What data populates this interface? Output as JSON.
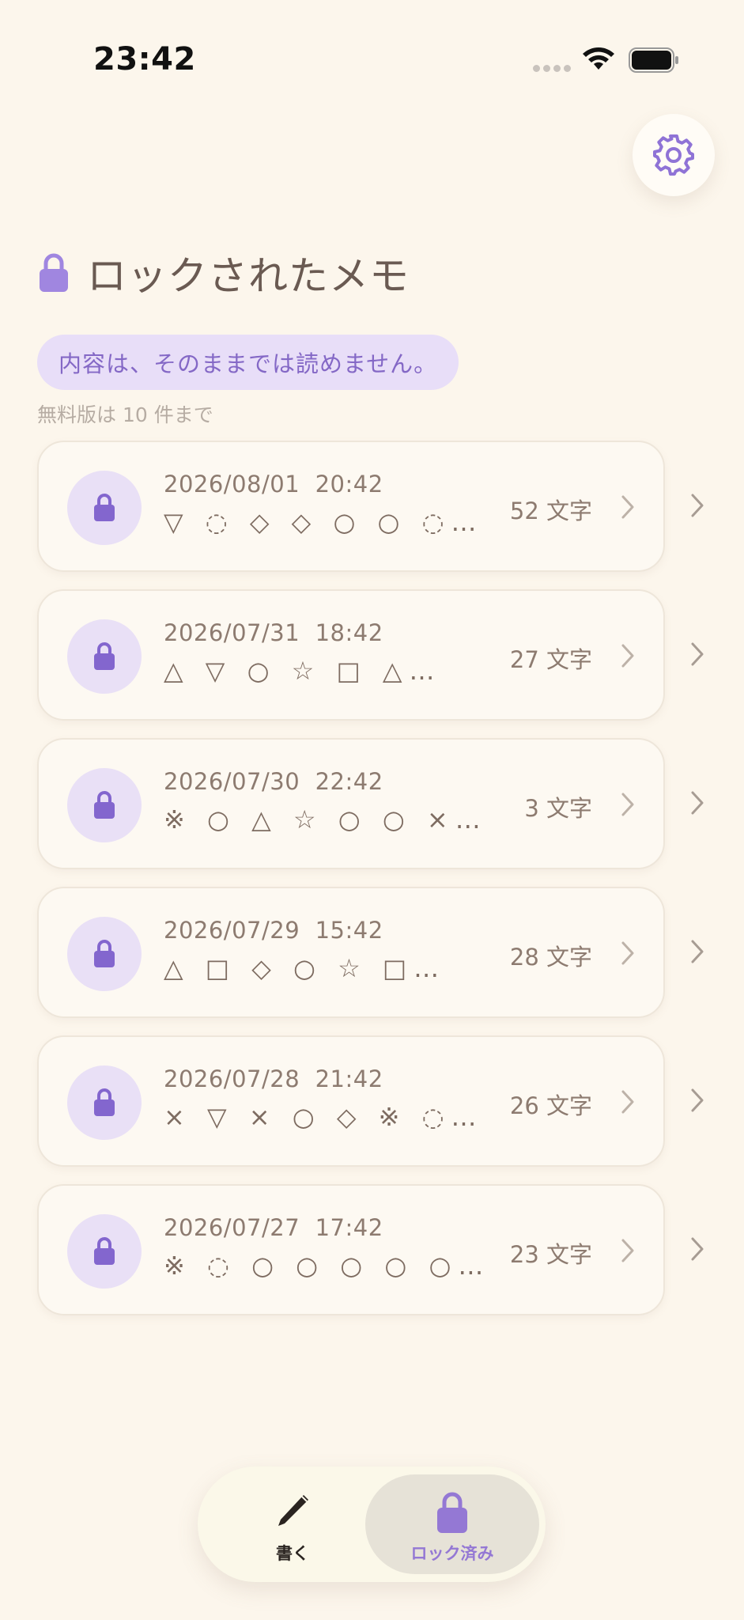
{
  "status_bar": {
    "time": "23:42"
  },
  "header": {
    "title": "ロックされたメモ",
    "notice": "内容は、そのままでは読めません。",
    "limit": "無料版は 10 件まで"
  },
  "icons": {
    "settings": "gear-icon",
    "lock": "lock-icon",
    "chevron": "chevron-right-icon",
    "write": "pencil-icon"
  },
  "colors": {
    "accent": "#9478D4",
    "background": "#FCF6EC",
    "notice_bg": "#E8DEF8"
  },
  "memos": [
    {
      "date": "2026/08/01  20:42",
      "preview": "▽ ◌ ◇ ◇ ○ ○ ◌…",
      "count": "52 文字"
    },
    {
      "date": "2026/07/31  18:42",
      "preview": "△ ▽ ○ ☆ □ △…",
      "count": "27 文字"
    },
    {
      "date": "2026/07/30  22:42",
      "preview": "※ ○ △ ☆ ○ ○ ×…",
      "count": "3 文字"
    },
    {
      "date": "2026/07/29  15:42",
      "preview": "△ □ ◇ ○ ☆ □…",
      "count": "28 文字"
    },
    {
      "date": "2026/07/28  21:42",
      "preview": "× ▽ × ○ ◇ ※ ◌…",
      "count": "26 文字"
    },
    {
      "date": "2026/07/27  17:42",
      "preview": "※ ◌ ○ ○ ○ ○ ○…",
      "count": "23 文字"
    }
  ],
  "bottom_nav": {
    "write_label": "書く",
    "locked_label": "ロック済み",
    "active": "locked"
  }
}
